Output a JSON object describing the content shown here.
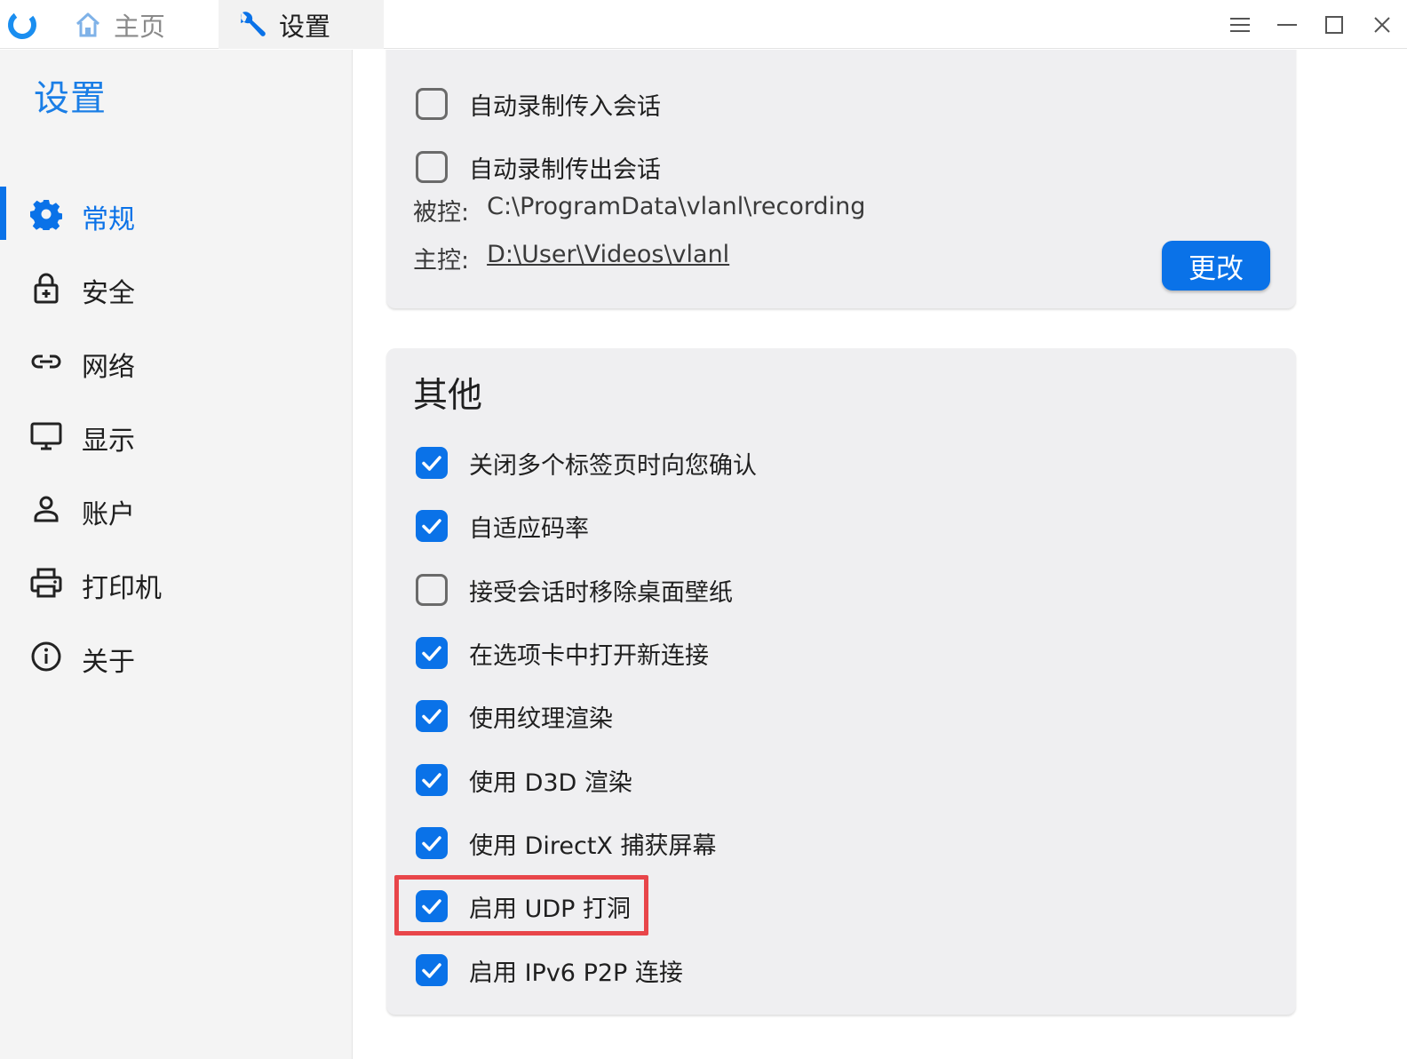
{
  "titlebar": {
    "tabs": [
      {
        "label": "主页",
        "icon": "home-icon"
      },
      {
        "label": "设置",
        "icon": "wrench-icon"
      }
    ],
    "controls": [
      "menu-icon",
      "minimize-icon",
      "maximize-icon",
      "close-icon"
    ]
  },
  "sidebar": {
    "title": "设置",
    "items": [
      {
        "label": "常规",
        "icon": "gear-icon",
        "active": true
      },
      {
        "label": "安全",
        "icon": "lock-icon"
      },
      {
        "label": "网络",
        "icon": "link-icon"
      },
      {
        "label": "显示",
        "icon": "monitor-icon"
      },
      {
        "label": "账户",
        "icon": "person-icon"
      },
      {
        "label": "打印机",
        "icon": "printer-icon"
      },
      {
        "label": "关于",
        "icon": "info-icon"
      }
    ]
  },
  "recording": {
    "options": [
      {
        "label": "自动录制传入会话",
        "checked": false
      },
      {
        "label": "自动录制传出会话",
        "checked": false
      }
    ],
    "controlled_label": "被控:",
    "controlled_path": "C:\\ProgramData\\vlanl\\recording",
    "controller_label": "主控:",
    "controller_path": "D:\\User\\Videos\\vlanl",
    "change_button": "更改"
  },
  "other": {
    "title": "其他",
    "options": [
      {
        "label": "关闭多个标签页时向您确认",
        "checked": true
      },
      {
        "label": "自适应码率",
        "checked": true
      },
      {
        "label": "接受会话时移除桌面壁纸",
        "checked": false
      },
      {
        "label": "在选项卡中打开新连接",
        "checked": true
      },
      {
        "label": "使用纹理渲染",
        "checked": true
      },
      {
        "label": "使用 D3D 渲染",
        "checked": true
      },
      {
        "label": "使用 DirectX 捕获屏幕",
        "checked": true
      },
      {
        "label": "启用 UDP 打洞",
        "checked": true,
        "highlighted": true
      },
      {
        "label": "启用 IPv6 P2P 连接",
        "checked": true
      }
    ]
  },
  "colors": {
    "accent": "#0a72e8",
    "highlight": "#e8454a",
    "card": "#efeff1",
    "sidebar": "#f4f4f4"
  }
}
